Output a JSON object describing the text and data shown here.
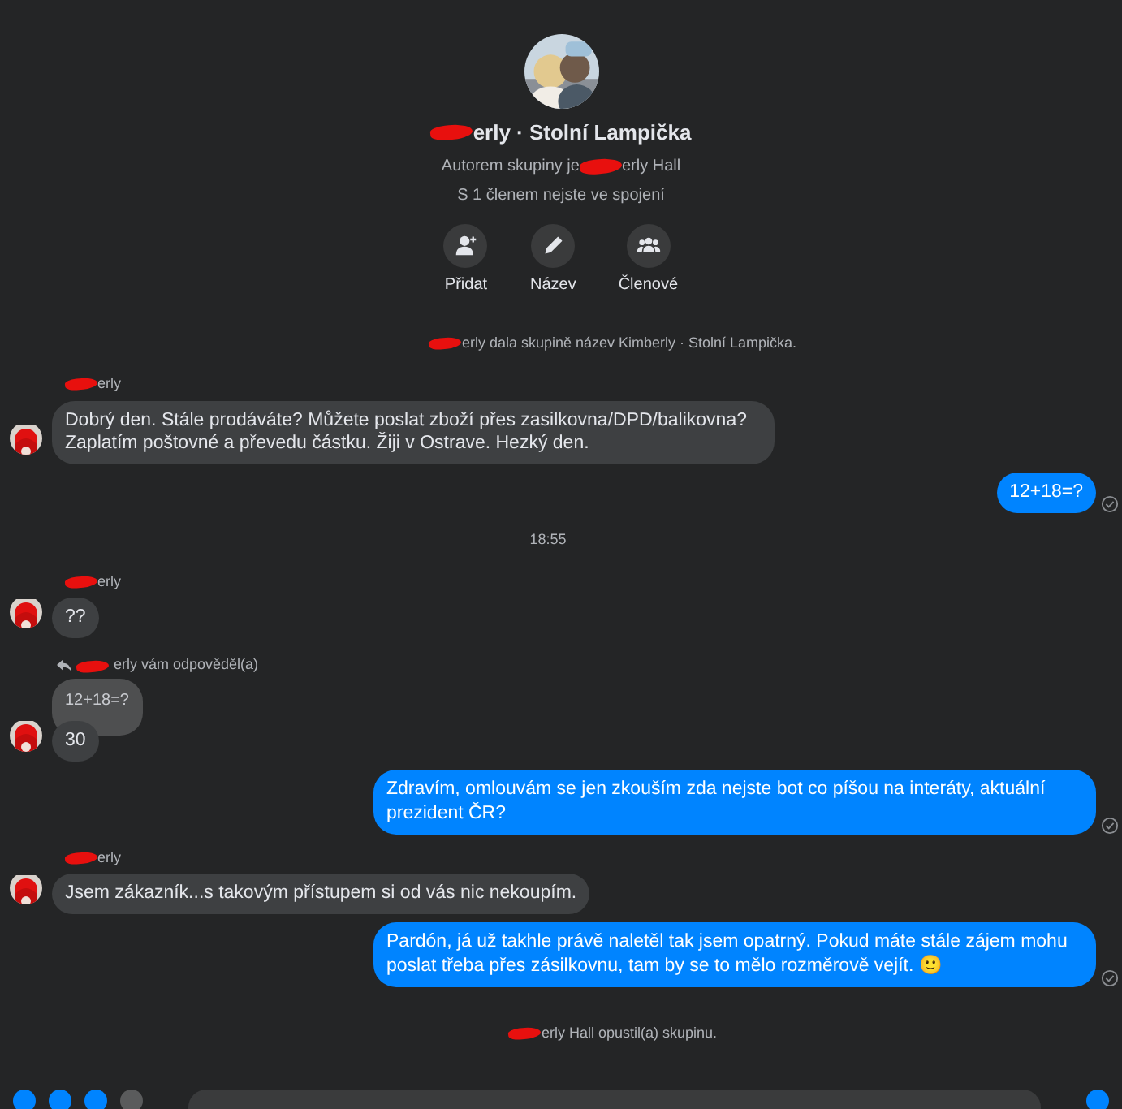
{
  "header": {
    "title": {
      "redacted": true,
      "text": "erly · Stolní Lampička"
    },
    "author": {
      "lead": "Autorem skupiny je",
      "redacted": true,
      "text": "erly Hall"
    },
    "connection": "S 1 členem nejste ve spojení",
    "actions": [
      {
        "kind": "add",
        "label": "Přidat"
      },
      {
        "kind": "edit",
        "label": "Název"
      },
      {
        "kind": "members",
        "label": "Členové"
      }
    ]
  },
  "messages": [
    {
      "kind": "system",
      "redacted": true,
      "text": "erly dala skupině název Kimberly · Stolní Lampička."
    },
    {
      "kind": "incoming",
      "sender": {
        "redacted": true,
        "text": "erly"
      },
      "bubbles": [
        "Dobrý den. Stále prodáváte? Můžete poslat zboží přes zasilkovna/DPD/balikovna? Zaplatím poštovné a převedu částku. Žiji v Ostrave. Hezký den."
      ]
    },
    {
      "kind": "outgoing",
      "text": "12+18=?"
    },
    {
      "kind": "time",
      "text": "18:55"
    },
    {
      "kind": "incoming",
      "sender": {
        "redacted": true,
        "text": "erly"
      },
      "bubbles": [
        "??"
      ]
    },
    {
      "kind": "incoming",
      "reply": {
        "redacted": true,
        "label": "erly vám odpověděl(a)",
        "quote": "12+18=?"
      },
      "bubbles": [
        "30"
      ]
    },
    {
      "kind": "outgoing",
      "text": "Zdravím, omlouvám se jen zkouším zda nejste bot co píšou na interáty, aktuální prezident ČR?"
    },
    {
      "kind": "incoming",
      "sender": {
        "redacted": true,
        "text": "erly"
      },
      "bubbles": [
        "Jsem zákazník...s takovým přístupem si od vás nic nekoupím."
      ]
    },
    {
      "kind": "outgoing",
      "text": "Pardón, já už takhle právě naletěl tak jsem opatrný. Pokud máte stále zájem mohu poslat třeba přes zásilkovnu, tam by se to mělo rozměrově vejít. 🙂"
    },
    {
      "kind": "system",
      "redacted": true,
      "text": "erly Hall opustil(a) skupinu."
    }
  ]
}
